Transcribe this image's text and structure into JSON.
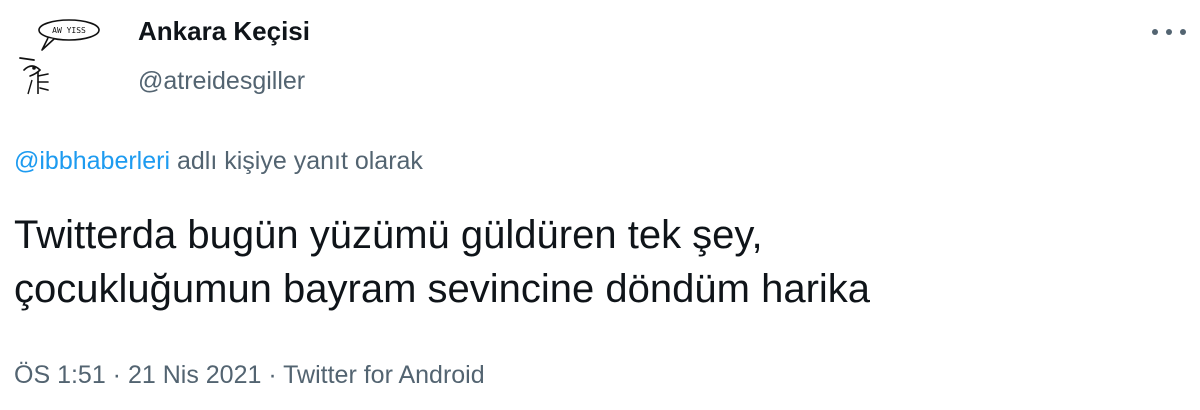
{
  "author": {
    "display_name": "Ankara Keçisi",
    "handle": "@atreidesgiller",
    "avatar_text": "AW YISS",
    "avatar_icon": "goat-doodle-icon"
  },
  "more_icon": "more-horizontal-icon",
  "reply": {
    "mention": "@ibbhaberleri",
    "suffix": " adlı kişiye yanıt olarak"
  },
  "tweet": {
    "line1": "Twitterda bugün yüzümü güldüren tek şey,",
    "line2": "çocukluğumun bayram sevincine döndüm harika"
  },
  "meta": {
    "time": "ÖS 1:51",
    "separator": " · ",
    "date": "21 Nis 2021",
    "source": "Twitter for Android"
  }
}
